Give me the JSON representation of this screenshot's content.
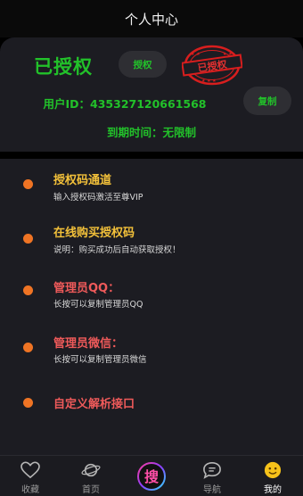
{
  "header": {
    "title": "个人中心"
  },
  "auth": {
    "status": "已授权",
    "auth_button": "授权",
    "stamp_text": "已授权",
    "user_id": "用户ID：435327120661568",
    "copy_button": "复制",
    "expiry": "到期时间：无限制"
  },
  "menu": {
    "items": [
      {
        "title": "授权码通道",
        "subtitle": "输入授权码激活至尊VIP",
        "color": "#f3c13a"
      },
      {
        "title": "在线购买授权码",
        "subtitle": "说明：购买成功后自动获取授权！",
        "color": "#f3c13a"
      },
      {
        "title": "管理员QQ：",
        "subtitle": "长按可以复制管理员QQ",
        "color": "#ef5a5a"
      },
      {
        "title": "管理员微信：",
        "subtitle": "长按可以复制管理员微信",
        "color": "#ef5a5a"
      },
      {
        "title": "自定义解析接口",
        "subtitle": "",
        "color": "#ef5a5a"
      }
    ]
  },
  "tabbar": {
    "tabs": [
      {
        "label": "收藏",
        "icon": "heart-icon"
      },
      {
        "label": "首页",
        "icon": "planet-icon"
      },
      {
        "label": "",
        "icon": "search-logo-icon",
        "glyph": "搜"
      },
      {
        "label": "导航",
        "icon": "chat-bubble-icon"
      },
      {
        "label": "我的",
        "icon": "smiley-face-icon",
        "active": true
      }
    ]
  },
  "colors": {
    "accent_green": "#22c12a",
    "dot_orange": "#ef7424",
    "title_yellow": "#f3c13a",
    "title_red": "#ef5a5a",
    "stamp_red": "#d81e1e",
    "active_tab": "#f6c21a"
  }
}
